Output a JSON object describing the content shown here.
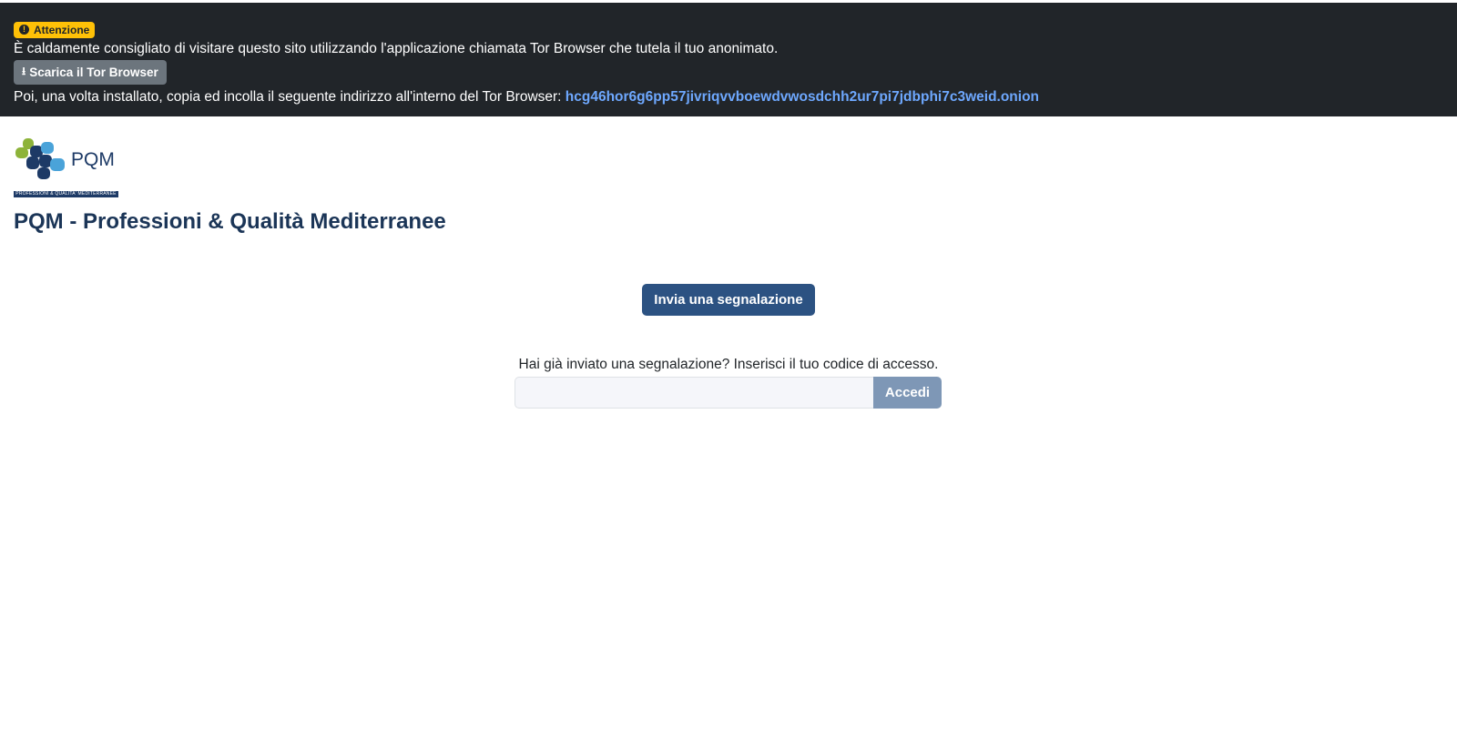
{
  "banner": {
    "badge_label": "Attenzione",
    "badge_icon": "exclamation-icon",
    "message": "È caldamente consigliato di visitare questo sito utilizzando l'applicazione chiamata Tor Browser che tutela il tuo anonimato.",
    "download_button_label": "Scarica il Tor Browser",
    "download_icon": "download-icon",
    "instructions": "Poi, una volta installato, copia ed incolla il seguente indirizzo all'interno del Tor Browser:",
    "onion_address": "hcg46hor6g6pp57jivriqvvboewdvwosdchh2ur7pi7jdbphi7c3weid.onion"
  },
  "logo": {
    "text": "PQM",
    "caption": "PROFESSIONI & QUALITA' MEDITERRANEE"
  },
  "page_title": "PQM - Professioni & Qualità Mediterranee",
  "submit_button_label": "Invia una segnalazione",
  "access": {
    "label": "Hai già inviato una segnalazione? Inserisci il tuo codice di accesso.",
    "input_value": "",
    "button_label": "Accedi"
  },
  "colors": {
    "banner_bg": "#212529",
    "badge_bg": "#ffc107",
    "primary": "#2c5282",
    "title": "#1b3557",
    "link": "#6ea8fe"
  }
}
